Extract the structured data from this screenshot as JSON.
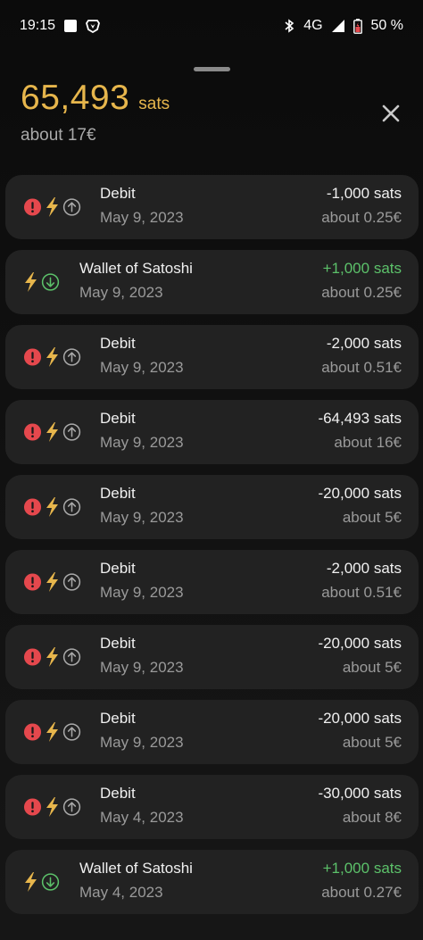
{
  "status_bar": {
    "time": "19:15",
    "network": "4G",
    "battery": "50 %"
  },
  "balance": {
    "amount": "65,493",
    "unit": "sats",
    "fiat": "about 17€"
  },
  "colors": {
    "accent": "#e7b64c",
    "positive": "#5cc16a",
    "error": "#e5484d",
    "card": "#222222"
  },
  "transactions": [
    {
      "type": "debit",
      "title": "Debit",
      "date": "May 9, 2023",
      "amount": "-1,000 sats",
      "fiat": "about 0.25€"
    },
    {
      "type": "credit",
      "title": "Wallet of Satoshi",
      "date": "May 9, 2023",
      "amount": "+1,000 sats",
      "fiat": "about 0.25€"
    },
    {
      "type": "debit",
      "title": "Debit",
      "date": "May 9, 2023",
      "amount": "-2,000 sats",
      "fiat": "about 0.51€"
    },
    {
      "type": "debit",
      "title": "Debit",
      "date": "May 9, 2023",
      "amount": "-64,493 sats",
      "fiat": "about 16€"
    },
    {
      "type": "debit",
      "title": "Debit",
      "date": "May 9, 2023",
      "amount": "-20,000 sats",
      "fiat": "about 5€"
    },
    {
      "type": "debit",
      "title": "Debit",
      "date": "May 9, 2023",
      "amount": "-2,000 sats",
      "fiat": "about 0.51€"
    },
    {
      "type": "debit",
      "title": "Debit",
      "date": "May 9, 2023",
      "amount": "-20,000 sats",
      "fiat": "about 5€"
    },
    {
      "type": "debit",
      "title": "Debit",
      "date": "May 9, 2023",
      "amount": "-20,000 sats",
      "fiat": "about 5€"
    },
    {
      "type": "debit",
      "title": "Debit",
      "date": "May 4, 2023",
      "amount": "-30,000 sats",
      "fiat": "about 8€"
    },
    {
      "type": "credit",
      "title": "Wallet of Satoshi",
      "date": "May 4, 2023",
      "amount": "+1,000 sats",
      "fiat": "about 0.27€"
    }
  ]
}
